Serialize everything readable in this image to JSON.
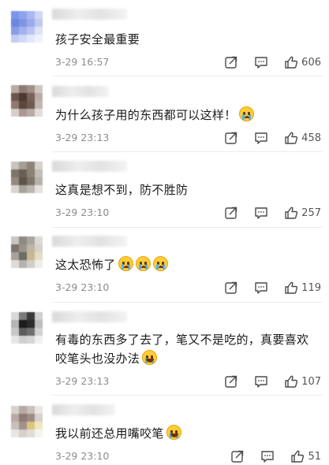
{
  "comments": [
    {
      "text": "孩子安全最重要",
      "emojis": [],
      "time": "3-29 16:57",
      "likes": "606",
      "avatar": [
        "#7d95e6",
        "#8fa3ea",
        "#a9b8ef",
        "#cfd7f4",
        "#6d86e0",
        "#8094e4",
        "#9aabeb",
        "#bfcaf1",
        "#8a9ce6",
        "#a2b2ec",
        "#b9c5f0",
        "#dde2f6",
        "#c4cdf1",
        "#d2d9f4",
        "#e3e7f8",
        "#f0f2fb"
      ]
    },
    {
      "text": "为什么孩子用的东西都可以这样！",
      "emojis": [
        "cry"
      ],
      "time": "3-29 23:13",
      "likes": "458",
      "avatar": [
        "#b8aba6",
        "#8e7b72",
        "#a08e88",
        "#cfc6c3",
        "#6e564c",
        "#4d3a32",
        "#7a6158",
        "#b9aba6",
        "#8f7a72",
        "#5d463d",
        "#6f5a52",
        "#c2b6b2",
        "#d6cecb",
        "#a99893",
        "#b8aaa5",
        "#e2dcda"
      ]
    },
    {
      "text": "这真是想不到，防不胜防",
      "emojis": [],
      "time": "3-29 23:10",
      "likes": "257",
      "avatar": [
        "#c8c3be",
        "#a59d94",
        "#8d8378",
        "#d5d1cd",
        "#7e756b",
        "#6a5f53",
        "#8b8175",
        "#c2bdb7",
        "#93897e",
        "#5e5449",
        "#7d7468",
        "#b7b1aa",
        "#d9d5d1",
        "#aaa39b",
        "#bcb6b0",
        "#e4e1de"
      ]
    },
    {
      "text": "这太恐怖了",
      "emojis": [
        "cry",
        "cry",
        "cry"
      ],
      "time": "3-29 23:10",
      "likes": "119",
      "avatar": [
        "#c9c6c2",
        "#8f8a84",
        "#a9a59f",
        "#dcdad7",
        "#7b756e",
        "#9a938a",
        "#bdb5a4",
        "#d7d2c8",
        "#a7a19a",
        "#6f6a63",
        "#c7b98e",
        "#e3dcc6",
        "#dedcd9",
        "#b6b2ad",
        "#d1cdc7",
        "#efedea"
      ]
    },
    {
      "text": "有毒的东西多了去了，笔又不是吃的，真要喜欢咬笔头也没办法",
      "emojis": [
        "laugh"
      ],
      "time": "3-29 23:13",
      "likes": "107",
      "avatar": [
        "#d9d9d9",
        "#7a7a7a",
        "#3a3a3a",
        "#cfcfcf",
        "#b5b5b5",
        "#1c1c1c",
        "#2b2b2b",
        "#bdbdbd",
        "#c7c7c7",
        "#5c5c5c",
        "#6e6e6e",
        "#d1d1d1",
        "#e6e6e6",
        "#cfcfcf",
        "#d6d6d6",
        "#f0f0f0"
      ]
    },
    {
      "text": "我以前还总用嘴咬笔",
      "emojis": [
        "laugh"
      ],
      "time": "3-29 23:10",
      "likes": "51",
      "avatar": [
        "#d7d2cf",
        "#b7a9a4",
        "#c9bfbb",
        "#ebe7e5",
        "#b9aaa5",
        "#8f7a74",
        "#a08c86",
        "#d8d0cd",
        "#cbbfbb",
        "#a3928c",
        "#d9c77a",
        "#efe6c2",
        "#e9e5e3",
        "#d6cfcc",
        "#e1dcd9",
        "#f5f3f2"
      ]
    }
  ],
  "icons": {
    "share": "share-icon",
    "comment": "comment-icon",
    "like": "thumbs-up-icon"
  },
  "colors": {
    "text": "#1a1a1a",
    "meta": "#8c8c8c",
    "icon": "#4a4a4a"
  }
}
